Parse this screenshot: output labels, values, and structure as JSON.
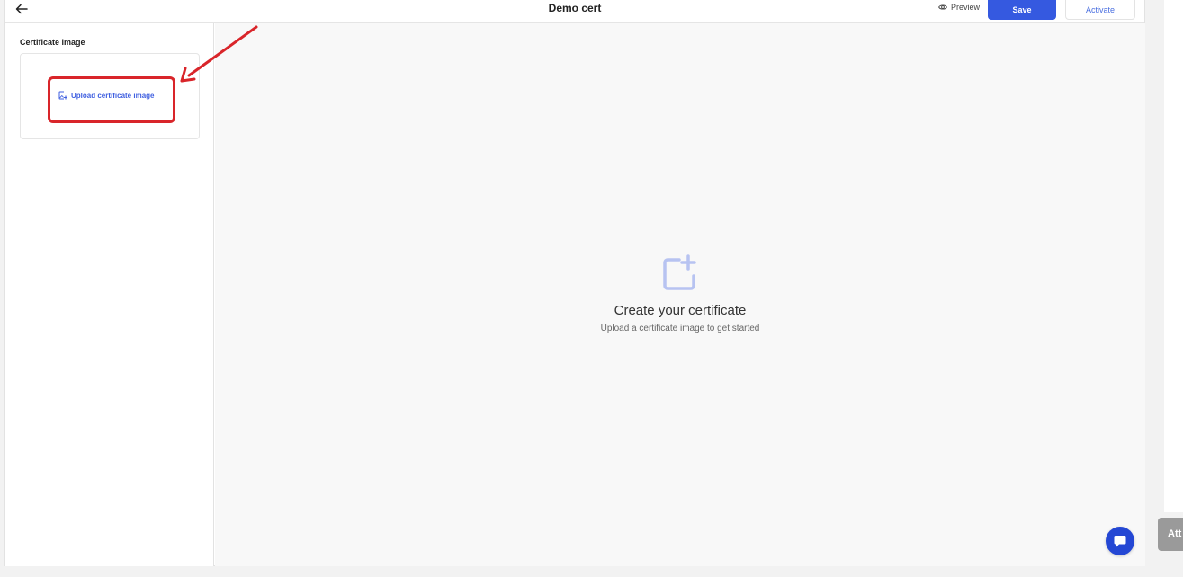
{
  "header": {
    "title": "Demo cert",
    "preview_label": "Preview",
    "save_label": "Save",
    "activate_label": "Activate"
  },
  "sidebar": {
    "heading": "Certificate image",
    "upload_label": "Upload certificate image"
  },
  "canvas": {
    "empty_title": "Create your certificate",
    "empty_subtitle": "Upload a certificate image to get started"
  },
  "side_tab": {
    "label": "Att"
  },
  "icons": {
    "back": "arrow-left-icon",
    "preview": "eye-icon",
    "upload": "image-add-icon",
    "empty_state": "square-plus-icon",
    "chat": "chat-bubble-icon"
  },
  "colors": {
    "primary": "#3559e0",
    "link": "#3f5fe0",
    "annotation": "#d9252a",
    "empty_icon": "#b7c3f1",
    "chat": "#2447d4"
  }
}
